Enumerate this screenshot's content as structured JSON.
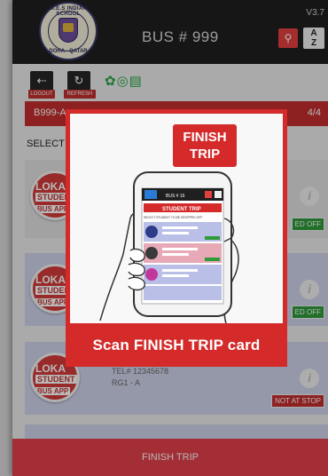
{
  "header": {
    "version": "V3.7",
    "logo_text_top": "M.E.S INDIAN SCHOOL",
    "logo_text_bottom": "DOHA - QATAR",
    "title": "BUS # 999",
    "sort_label": "A\nZ"
  },
  "toolbar": {
    "logout_label": "LOGOUT",
    "refresh_label": "REFRESH",
    "icons": [
      "wifi-icon",
      "gps-icon",
      "phone-icon"
    ]
  },
  "trip_bar": {
    "trip_id": "B999-A",
    "count": "4/4"
  },
  "select_label": "SELECT",
  "students": [
    {
      "badge": [
        "LOKA",
        "STUDENT",
        "BUS APP"
      ],
      "status": "ED OFF",
      "status_color": "#2f9a3a",
      "lines": []
    },
    {
      "badge": [
        "LOKA",
        "STUDENT",
        "BUS APP"
      ],
      "status": "ED OFF",
      "status_color": "#2f9a3a",
      "lines": []
    },
    {
      "badge": [
        "LOKA",
        "STUDENT",
        "BUS APP"
      ],
      "status": "NOT AT STOP",
      "status_color": "#c42f2f",
      "lines": [
        "TEL# 12345678",
        "RG1 - A"
      ]
    }
  ],
  "finish_button": "FINISH TRIP",
  "modal": {
    "tag_line1": "FINISH",
    "tag_line2": "TRIP",
    "caption": "Scan FINISH TRIP card",
    "phone": {
      "title": "BUS # 16",
      "header": "STUDENT TRIP",
      "sub": "SELECT STUDENT TO BE DROPPED OFF"
    }
  },
  "colors": {
    "accent_red": "#d42a2a",
    "header_dark": "#1f1f1f",
    "finish_bar": "#e2414a"
  }
}
